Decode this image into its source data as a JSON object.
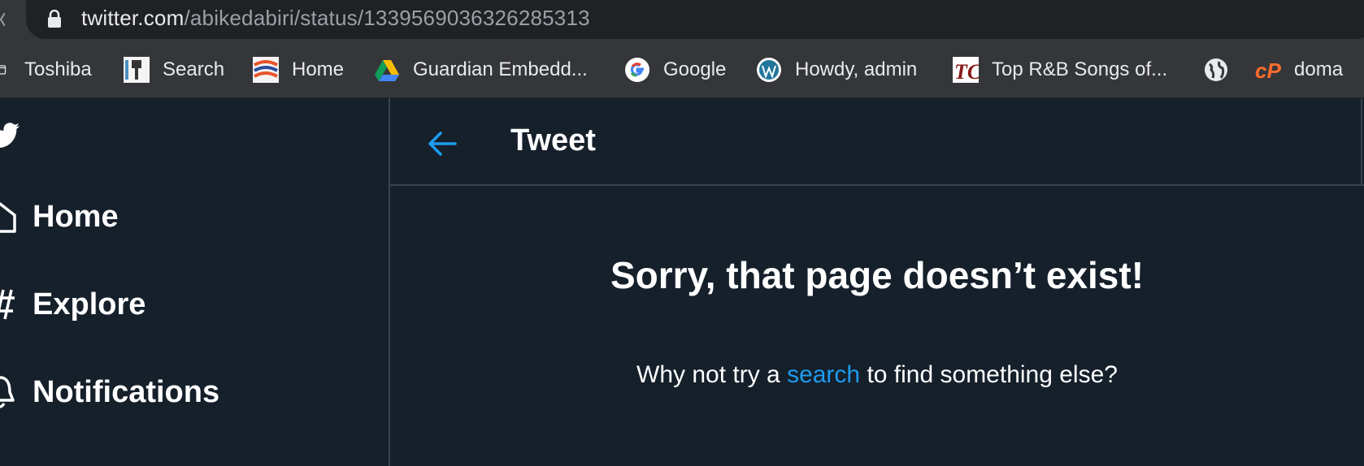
{
  "browser": {
    "url_host": "twitter.com",
    "url_path": "/abikedabiri/status/1339569036326285313"
  },
  "bookmarks": [
    {
      "label": "Toshiba",
      "icon": "folder-icon"
    },
    {
      "label": "Search",
      "icon": "search-bookmark-icon"
    },
    {
      "label": "Home",
      "icon": "home-bookmark-icon"
    },
    {
      "label": "Guardian Embedd...",
      "icon": "google-drive-icon"
    },
    {
      "label": "Google",
      "icon": "google-icon"
    },
    {
      "label": "Howdy, admin",
      "icon": "wordpress-icon"
    },
    {
      "label": "Top R&B Songs of...",
      "icon": "tc-logo-icon"
    },
    {
      "label": "",
      "icon": "globe-icon"
    },
    {
      "label": "doma",
      "icon": "cpanel-icon"
    }
  ],
  "sidebar": {
    "items": [
      {
        "label": "Home",
        "icon": "home-icon"
      },
      {
        "label": "Explore",
        "icon": "hashtag-icon"
      },
      {
        "label": "Notifications",
        "icon": "bell-icon"
      }
    ]
  },
  "header": {
    "title": "Tweet"
  },
  "error": {
    "title": "Sorry, that page doesn’t exist!",
    "sub_before": "Why not try a ",
    "sub_link": "search",
    "sub_after": " to find something else?"
  },
  "colors": {
    "background": "#15202b",
    "accent": "#1d9bf0",
    "border": "#38444d"
  }
}
